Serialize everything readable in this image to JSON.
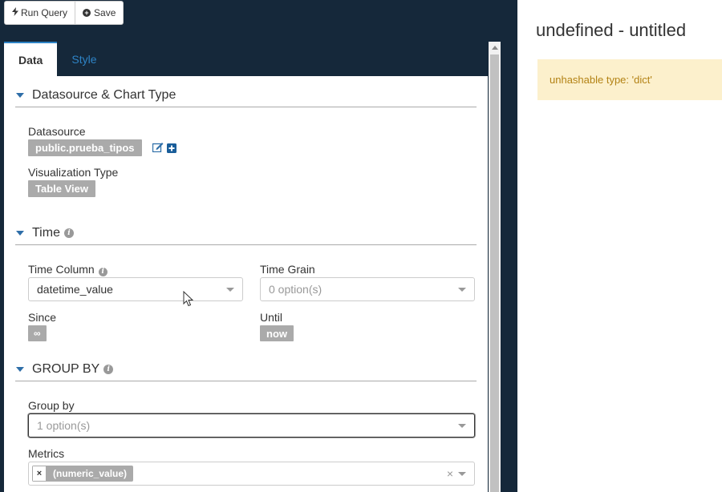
{
  "toolbar": {
    "run_query_label": "Run Query",
    "save_label": "Save"
  },
  "tabs": [
    {
      "label": "Data",
      "active": true
    },
    {
      "label": "Style",
      "active": false
    }
  ],
  "sections": {
    "datasource": {
      "title": "Datasource & Chart Type",
      "datasource_label": "Datasource",
      "datasource_value": "public.prueba_tipos",
      "viz_label": "Visualization Type",
      "viz_value": "Table View"
    },
    "time": {
      "title": "Time",
      "time_column_label": "Time Column",
      "time_column_value": "datetime_value",
      "time_grain_label": "Time Grain",
      "time_grain_placeholder": "0 option(s)",
      "since_label": "Since",
      "since_value": "∞",
      "until_label": "Until",
      "until_value": "now"
    },
    "groupby": {
      "title": "GROUP BY",
      "group_by_label": "Group by",
      "group_by_placeholder": "1 option(s)",
      "metrics_label": "Metrics",
      "metrics_value": "(numeric_value)",
      "remove_symbol": "×",
      "clear_symbol": "×"
    }
  },
  "chart": {
    "title": "undefined - untitled",
    "error": "unhashable type: 'dict'"
  },
  "colors": {
    "dark_bg": "#15283a",
    "accent": "#2e84c6",
    "alert_bg": "#fcf0cc",
    "alert_text": "#b38214",
    "tag_bg": "#aaaaaa"
  }
}
